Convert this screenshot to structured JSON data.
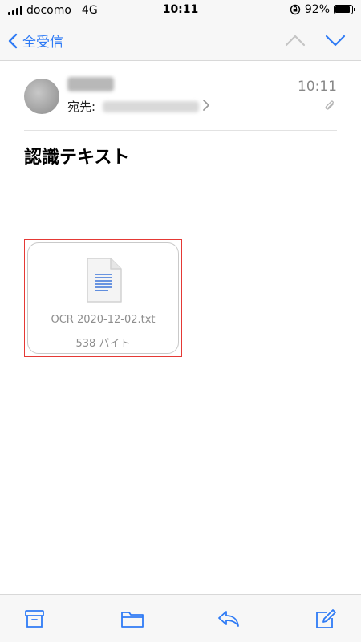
{
  "status_bar": {
    "carrier": "docomo",
    "network": "4G",
    "time": "10:11",
    "battery_text": "92%",
    "battery_level": 0.92
  },
  "nav": {
    "back_label": "全受信",
    "up_icon": "chevron-up-icon",
    "down_icon": "chevron-down-icon"
  },
  "message": {
    "to_label": "宛先:",
    "time": "10:11",
    "subject": "認識テキスト"
  },
  "attachment": {
    "file_name": "OCR 2020-12-02.txt",
    "file_size": "538 バイト"
  },
  "toolbar": {
    "items": [
      "archive-icon",
      "folder-icon",
      "reply-icon",
      "compose-icon"
    ]
  },
  "colors": {
    "accent": "#2f7bf5",
    "highlight_border": "#e53935"
  }
}
